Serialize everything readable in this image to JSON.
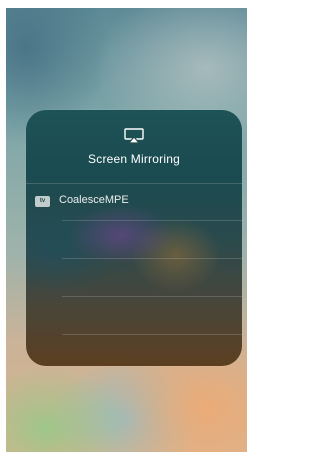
{
  "panel": {
    "title": "Screen Mirroring",
    "icon": "airplay-icon",
    "devices": [
      {
        "badge": "tv",
        "icon": "apple-tv-icon",
        "name": "CoalesceMPE"
      }
    ]
  }
}
